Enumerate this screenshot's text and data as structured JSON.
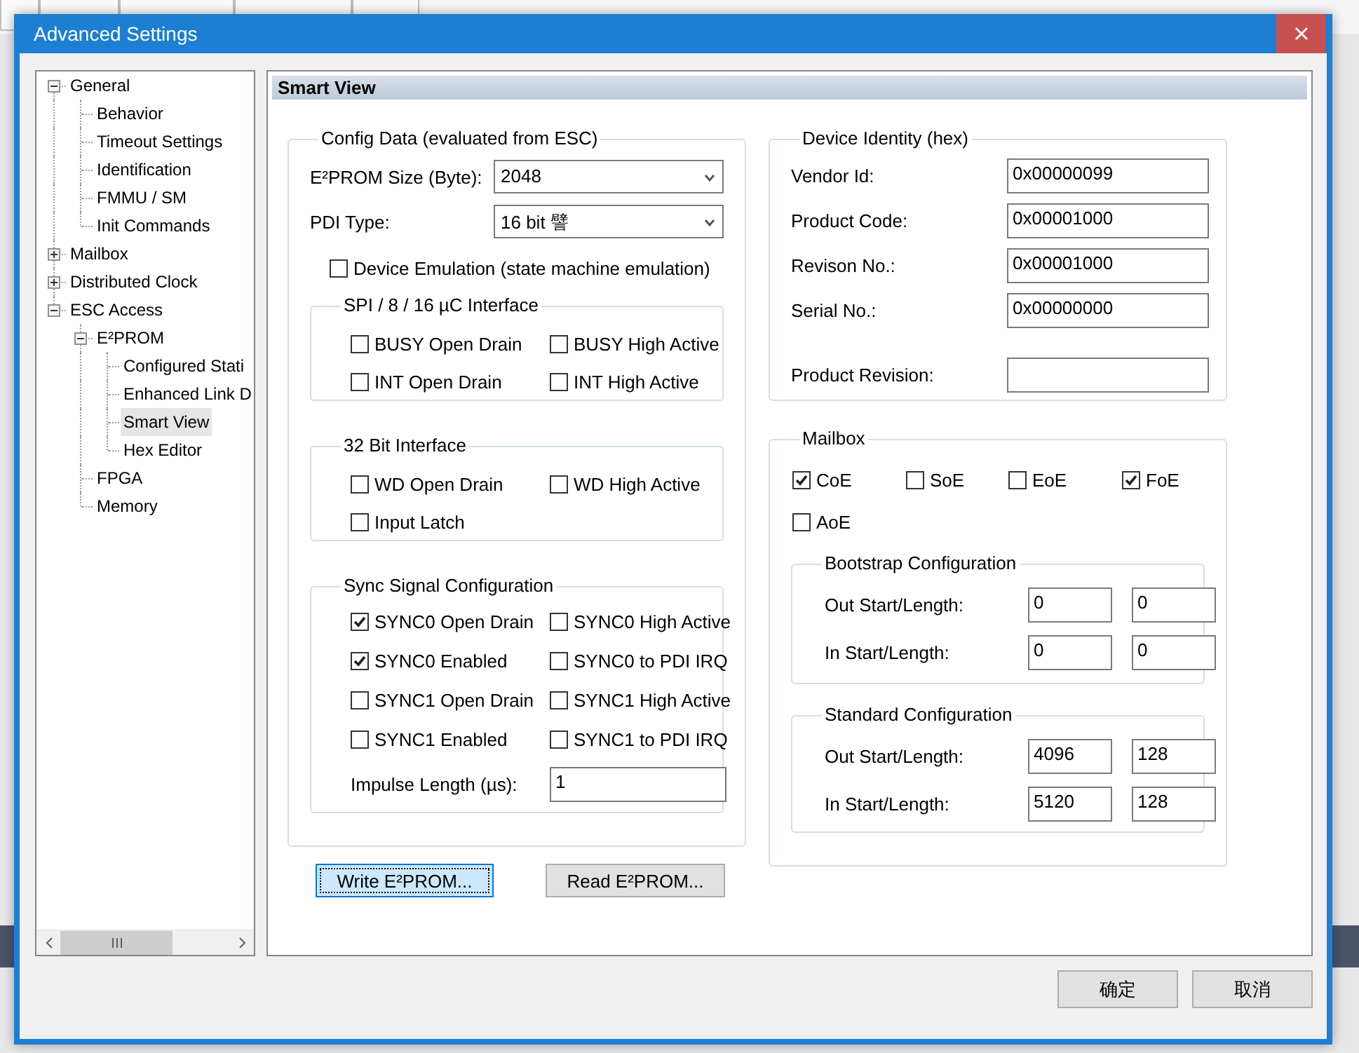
{
  "window": {
    "title": "Advanced Settings"
  },
  "tree": [
    {
      "label": "General",
      "expanded": true,
      "selected": false,
      "children": [
        {
          "label": "Behavior",
          "selected": false
        },
        {
          "label": "Timeout Settings",
          "selected": false
        },
        {
          "label": "Identification",
          "selected": false
        },
        {
          "label": "FMMU / SM",
          "selected": false
        },
        {
          "label": "Init Commands",
          "selected": false
        }
      ]
    },
    {
      "label": "Mailbox",
      "expanded": false,
      "selected": false
    },
    {
      "label": "Distributed Clock",
      "expanded": false,
      "selected": false
    },
    {
      "label": "ESC Access",
      "expanded": true,
      "selected": false,
      "children": [
        {
          "label": "E²PROM",
          "expanded": true,
          "selected": false,
          "children": [
            {
              "label": "Configured Stati",
              "selected": false
            },
            {
              "label": "Enhanced Link D",
              "selected": false
            },
            {
              "label": "Smart View",
              "selected": true
            },
            {
              "label": "Hex Editor",
              "selected": false
            }
          ]
        },
        {
          "label": "FPGA",
          "selected": false
        },
        {
          "label": "Memory",
          "selected": false
        }
      ]
    }
  ],
  "panel": {
    "title": "Smart View"
  },
  "config_data": {
    "title": "Config Data (evaluated from ESC)",
    "dropdowns": [
      {
        "label": "E²PROM Size (Byte):",
        "value": "2048"
      },
      {
        "label": "PDI Type:",
        "value": "16 bit 譬"
      }
    ],
    "emulation": {
      "label": "Device Emulation (state machine emulation)",
      "checked": false
    },
    "groups": [
      {
        "title": "SPI / 8 / 16 µC Interface",
        "options": [
          {
            "label": "BUSY Open Drain",
            "checked": false
          },
          {
            "label": "BUSY High Active",
            "checked": false
          },
          {
            "label": "INT Open Drain",
            "checked": false
          },
          {
            "label": "INT High Active",
            "checked": false
          }
        ]
      },
      {
        "title": "32 Bit Interface",
        "options": [
          {
            "label": "WD Open Drain",
            "checked": false
          },
          {
            "label": "WD High Active",
            "checked": false
          },
          {
            "label": "Input Latch",
            "checked": false
          }
        ]
      },
      {
        "title": "Sync Signal Configuration",
        "options": [
          {
            "label": "SYNC0 Open Drain",
            "checked": true
          },
          {
            "label": "SYNC0 High Active",
            "checked": false
          },
          {
            "label": "SYNC0 Enabled",
            "checked": true
          },
          {
            "label": "SYNC0 to PDI IRQ",
            "checked": false
          },
          {
            "label": "SYNC1 Open Drain",
            "checked": false
          },
          {
            "label": "SYNC1 High Active",
            "checked": false
          },
          {
            "label": "SYNC1 Enabled",
            "checked": false
          },
          {
            "label": "SYNC1 to PDI IRQ",
            "checked": false
          }
        ],
        "impulse": {
          "label": "Impulse Length (µs):",
          "value": "1"
        }
      }
    ]
  },
  "eeprom_buttons": [
    {
      "label": "Write E²PROM...",
      "focused": true
    },
    {
      "label": "Read E²PROM...",
      "focused": false
    }
  ],
  "device_identity": {
    "title": "Device Identity (hex)",
    "fields": [
      {
        "label": "Vendor Id:",
        "value": "0x00000099"
      },
      {
        "label": "Product Code:",
        "value": "0x00001000"
      },
      {
        "label": "Revison No.:",
        "value": "0x00001000"
      },
      {
        "label": "Serial No.:",
        "value": "0x00000000"
      },
      {
        "label": "Product Revision:"
      }
    ]
  },
  "mailbox": {
    "title": "Mailbox",
    "protocols": [
      {
        "label": "CoE",
        "checked": true
      },
      {
        "label": "SoE",
        "checked": false
      },
      {
        "label": "EoE",
        "checked": false
      },
      {
        "label": "FoE",
        "checked": true
      },
      {
        "label": "AoE",
        "checked": false
      }
    ],
    "configs": [
      {
        "title": "Bootstrap Configuration",
        "rows": [
          {
            "label": "Out Start/Length:",
            "start": "0",
            "length": "0"
          },
          {
            "label": "In Start/Length:",
            "start": "0",
            "length": "0"
          }
        ]
      },
      {
        "title": "Standard Configuration",
        "rows": [
          {
            "label": "Out Start/Length:",
            "start": "4096",
            "length": "128"
          },
          {
            "label": "In Start/Length:",
            "start": "5120",
            "length": "128"
          }
        ]
      }
    ]
  },
  "dialog_buttons": [
    "确定",
    "取消"
  ]
}
